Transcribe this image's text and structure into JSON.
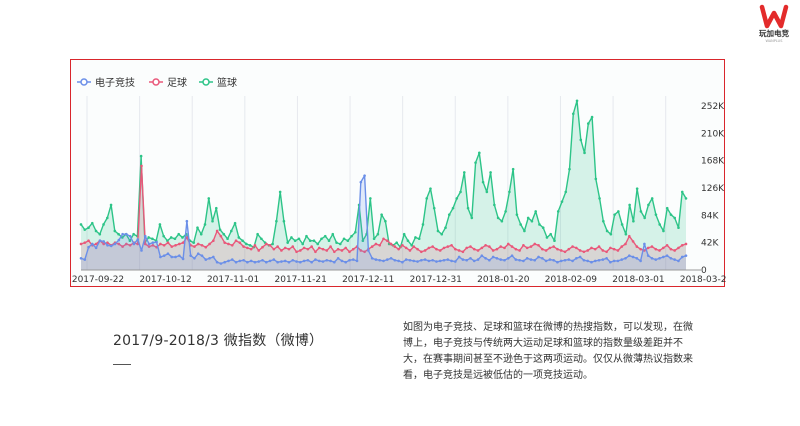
{
  "brand": {
    "logo_lines": [
      "玩加电竞",
      "WANPLUS"
    ],
    "color": "#e32b2b"
  },
  "heading": "2017/9-2018/3 微指数（微博）",
  "description": "如图为电子竞技、足球和篮球在微博的热搜指数，可以发现，在微博上，电子竞技与传统两大运动足球和篮球的指数量级差距并不大，在赛事期间甚至不逊色于这两项运动。仅仅从微薄热议指数来看，电子竞技是远被低估的一项竞技运动。",
  "chart_data": {
    "type": "area",
    "legend_position": "top-left",
    "series": [
      {
        "name": "电子竞技",
        "color": "#6b8fe8",
        "values": [
          18,
          16,
          35,
          40,
          34,
          45,
          44,
          38,
          37,
          40,
          46,
          55,
          55,
          52,
          40,
          47,
          30,
          52,
          40,
          42,
          43,
          20,
          22,
          25,
          20,
          20,
          22,
          17,
          75,
          22,
          18,
          25,
          22,
          16,
          18,
          20,
          12,
          10,
          12,
          14,
          16,
          12,
          14,
          15,
          12,
          14,
          12,
          13,
          15,
          12,
          14,
          16,
          12,
          13,
          14,
          12,
          15,
          13,
          12,
          14,
          15,
          12,
          16,
          14,
          13,
          15,
          14,
          12,
          18,
          14,
          12,
          15,
          16,
          14,
          135,
          145,
          30,
          18,
          16,
          15,
          14,
          16,
          18,
          15,
          14,
          12,
          16,
          15,
          14,
          13,
          15,
          16,
          14,
          15,
          13,
          14,
          15,
          16,
          14,
          13,
          20,
          16,
          15,
          18,
          14,
          16,
          22,
          18,
          15,
          20,
          18,
          16,
          15,
          18,
          22,
          16,
          15,
          14,
          18,
          16,
          15,
          20,
          18,
          14,
          16,
          15,
          12,
          14,
          15,
          16,
          14,
          18,
          20,
          15,
          14,
          12,
          14,
          15,
          16,
          18,
          12,
          14,
          14,
          16,
          18,
          22,
          20,
          18,
          14,
          40,
          22,
          18,
          16,
          18,
          20,
          22,
          18,
          16,
          14,
          20,
          22
        ]
      },
      {
        "name": "足球",
        "color": "#e9587a",
        "values": [
          40,
          42,
          45,
          38,
          40,
          45,
          40,
          42,
          38,
          42,
          40,
          36,
          40,
          38,
          42,
          40,
          160,
          40,
          36,
          38,
          35,
          40,
          38,
          42,
          36,
          38,
          40,
          42,
          50,
          38,
          36,
          40,
          38,
          35,
          40,
          45,
          60,
          52,
          42,
          40,
          38,
          45,
          42,
          36,
          34,
          32,
          38,
          30,
          35,
          40,
          38,
          32,
          36,
          30,
          34,
          32,
          36,
          28,
          30,
          34,
          32,
          36,
          28,
          34,
          32,
          30,
          36,
          28,
          32,
          30,
          34,
          28,
          32,
          36,
          30,
          28,
          32,
          36,
          40,
          38,
          48,
          45,
          40,
          36,
          32,
          38,
          34,
          30,
          36,
          32,
          28,
          30,
          34,
          36,
          32,
          30,
          34,
          36,
          38,
          32,
          30,
          28,
          34,
          36,
          32,
          30,
          34,
          38,
          36,
          30,
          32,
          36,
          34,
          40,
          36,
          32,
          30,
          38,
          34,
          36,
          40,
          38,
          32,
          30,
          34,
          36,
          32,
          30,
          28,
          32,
          36,
          34,
          30,
          28,
          30,
          34,
          32,
          36,
          30,
          28,
          34,
          32,
          30,
          36,
          40,
          52,
          44,
          36,
          32,
          30,
          34,
          36,
          32,
          30,
          34,
          38,
          32,
          30,
          34,
          38,
          40
        ]
      },
      {
        "name": "篮球",
        "color": "#2dc488",
        "values": [
          70,
          62,
          65,
          72,
          60,
          55,
          70,
          80,
          100,
          60,
          55,
          50,
          55,
          45,
          55,
          52,
          175,
          42,
          50,
          48,
          45,
          70,
          52,
          45,
          50,
          48,
          55,
          50,
          55,
          45,
          42,
          65,
          55,
          70,
          110,
          75,
          95,
          62,
          55,
          48,
          60,
          72,
          50,
          45,
          40,
          38,
          35,
          55,
          48,
          42,
          38,
          40,
          75,
          120,
          75,
          42,
          50,
          45,
          48,
          40,
          52,
          45,
          45,
          40,
          48,
          52,
          45,
          55,
          42,
          40,
          48,
          45,
          52,
          58,
          100,
          45,
          55,
          110,
          48,
          55,
          85,
          75,
          40,
          38,
          42,
          35,
          55,
          45,
          38,
          50,
          48,
          70,
          110,
          125,
          95,
          60,
          55,
          65,
          85,
          95,
          110,
          120,
          150,
          95,
          80,
          165,
          180,
          135,
          120,
          150,
          100,
          80,
          75,
          90,
          120,
          155,
          85,
          70,
          60,
          80,
          75,
          90,
          70,
          65,
          50,
          55,
          45,
          90,
          105,
          120,
          155,
          240,
          260,
          200,
          180,
          225,
          235,
          140,
          110,
          75,
          60,
          55,
          85,
          90,
          70,
          55,
          100,
          75,
          125,
          90,
          80,
          100,
          110,
          85,
          70,
          60,
          95,
          85,
          80,
          65,
          120,
          110
        ]
      }
    ],
    "x_tick_labels": [
      "2017-09-22",
      "2017-10-12",
      "2017-11-01",
      "2017-11-21",
      "2017-12-11",
      "2017-12-31",
      "2018-01-20",
      "2018-02-09",
      "2018-03-01",
      "2018-03-21"
    ],
    "x_range": [
      "2017-09-22",
      "2018-03-21"
    ],
    "y_tick_labels": [
      "0",
      "42K",
      "84K",
      "126K",
      "168K",
      "210K",
      "252K"
    ],
    "y_unit": "K",
    "ylim": [
      0,
      252
    ],
    "y_axis_position": "right",
    "grid": "vertical"
  }
}
